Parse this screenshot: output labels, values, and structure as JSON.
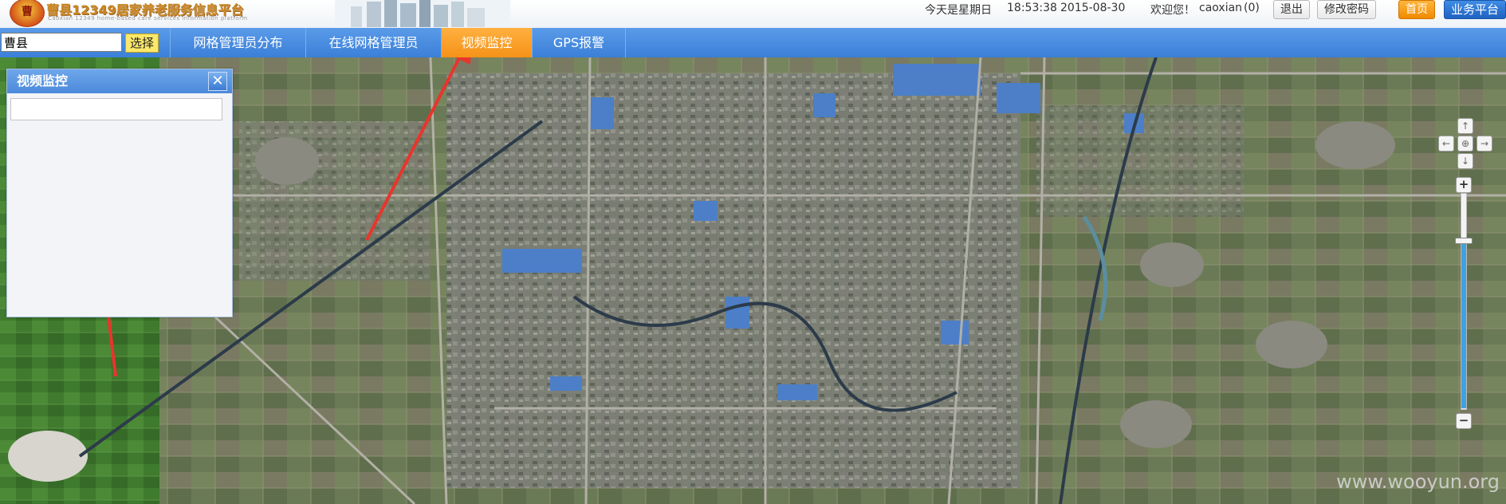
{
  "header": {
    "logo_badge": "曹",
    "logo_title": "曹县12349居家养老服务信息平台",
    "logo_subtitle": "Caoxian 12349 home-based care services information platform",
    "weekday_text": "今天是星期日",
    "time": "18:53:38",
    "date": "2015-08-30",
    "welcome": "欢迎您！",
    "username": "caoxian",
    "message_count": "(0)",
    "logout_label": "退出",
    "change_password_label": "修改密码",
    "home_label": "首页",
    "business_label": "业务平台"
  },
  "nav": {
    "search_value": "曹县",
    "select_label": "选择",
    "tabs": [
      {
        "label": "网格管理员分布",
        "active": false
      },
      {
        "label": "在线网格管理员",
        "active": false
      },
      {
        "label": "视频监控",
        "active": true
      },
      {
        "label": "GPS报警",
        "active": false
      }
    ]
  },
  "panel": {
    "title": "视频监控",
    "close_icon": "close-icon",
    "search_value": ""
  },
  "map_controls": {
    "pan_up_icon": "↑",
    "pan_left_icon": "←",
    "pan_right_icon": "→",
    "pan_down_icon": "↓",
    "pan_center_icon": "⊕",
    "zoom_in_label": "+",
    "zoom_out_label": "−",
    "zoom_level_fraction": 0.78
  },
  "watermark": "www.wooyun.org",
  "colors": {
    "nav_blue": "#4a8be0",
    "tab_active_orange": "#f59218",
    "time_red": "#d81e06",
    "annotation_red": "#e8352c"
  }
}
